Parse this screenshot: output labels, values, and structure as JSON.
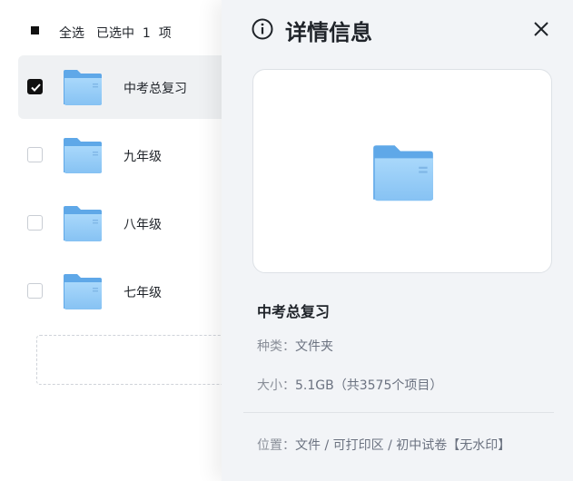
{
  "list": {
    "select_all_label": "全选",
    "selected_count_text": "已选中  1  项",
    "items": [
      {
        "name": "中考总复习",
        "checked": true
      },
      {
        "name": "九年级",
        "checked": false
      },
      {
        "name": "八年级",
        "checked": false
      },
      {
        "name": "七年级",
        "checked": false
      }
    ]
  },
  "detail": {
    "title": "详情信息",
    "file_name": "中考总复习",
    "type_label": "种类：",
    "type_value": "文件夹",
    "size_label": "大小：",
    "size_value": "5.1GB（共3575个项目）",
    "location_label": "位置：",
    "location_value": "文件 / 可打印区 / 初中试卷【无水印】"
  },
  "icons": {
    "folder": "folder-icon",
    "info": "info-icon",
    "close": "close-icon",
    "check": "checkmark-icon"
  },
  "colors": {
    "folder_back": "#5fa8e8",
    "folder_front": "#9dd0f8",
    "checked_fill": "#111111",
    "panel_bg": "#f2f4f7"
  }
}
